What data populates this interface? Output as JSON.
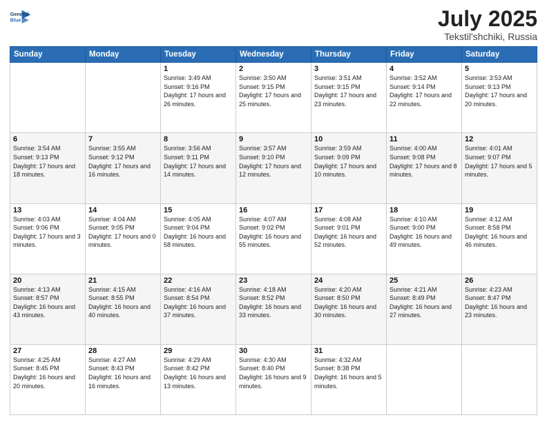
{
  "header": {
    "title": "July 2025",
    "subtitle": "Tekstil'shchiki, Russia"
  },
  "logo": {
    "line1": "General",
    "line2": "Blue"
  },
  "days_of_week": [
    "Sunday",
    "Monday",
    "Tuesday",
    "Wednesday",
    "Thursday",
    "Friday",
    "Saturday"
  ],
  "weeks": [
    [
      {
        "day": "",
        "info": ""
      },
      {
        "day": "",
        "info": ""
      },
      {
        "day": "1",
        "info": "Sunrise: 3:49 AM\nSunset: 9:16 PM\nDaylight: 17 hours and 26 minutes."
      },
      {
        "day": "2",
        "info": "Sunrise: 3:50 AM\nSunset: 9:15 PM\nDaylight: 17 hours and 25 minutes."
      },
      {
        "day": "3",
        "info": "Sunrise: 3:51 AM\nSunset: 9:15 PM\nDaylight: 17 hours and 23 minutes."
      },
      {
        "day": "4",
        "info": "Sunrise: 3:52 AM\nSunset: 9:14 PM\nDaylight: 17 hours and 22 minutes."
      },
      {
        "day": "5",
        "info": "Sunrise: 3:53 AM\nSunset: 9:13 PM\nDaylight: 17 hours and 20 minutes."
      }
    ],
    [
      {
        "day": "6",
        "info": "Sunrise: 3:54 AM\nSunset: 9:13 PM\nDaylight: 17 hours and 18 minutes."
      },
      {
        "day": "7",
        "info": "Sunrise: 3:55 AM\nSunset: 9:12 PM\nDaylight: 17 hours and 16 minutes."
      },
      {
        "day": "8",
        "info": "Sunrise: 3:56 AM\nSunset: 9:11 PM\nDaylight: 17 hours and 14 minutes."
      },
      {
        "day": "9",
        "info": "Sunrise: 3:57 AM\nSunset: 9:10 PM\nDaylight: 17 hours and 12 minutes."
      },
      {
        "day": "10",
        "info": "Sunrise: 3:59 AM\nSunset: 9:09 PM\nDaylight: 17 hours and 10 minutes."
      },
      {
        "day": "11",
        "info": "Sunrise: 4:00 AM\nSunset: 9:08 PM\nDaylight: 17 hours and 8 minutes."
      },
      {
        "day": "12",
        "info": "Sunrise: 4:01 AM\nSunset: 9:07 PM\nDaylight: 17 hours and 5 minutes."
      }
    ],
    [
      {
        "day": "13",
        "info": "Sunrise: 4:03 AM\nSunset: 9:06 PM\nDaylight: 17 hours and 3 minutes."
      },
      {
        "day": "14",
        "info": "Sunrise: 4:04 AM\nSunset: 9:05 PM\nDaylight: 17 hours and 0 minutes."
      },
      {
        "day": "15",
        "info": "Sunrise: 4:05 AM\nSunset: 9:04 PM\nDaylight: 16 hours and 58 minutes."
      },
      {
        "day": "16",
        "info": "Sunrise: 4:07 AM\nSunset: 9:02 PM\nDaylight: 16 hours and 55 minutes."
      },
      {
        "day": "17",
        "info": "Sunrise: 4:08 AM\nSunset: 9:01 PM\nDaylight: 16 hours and 52 minutes."
      },
      {
        "day": "18",
        "info": "Sunrise: 4:10 AM\nSunset: 9:00 PM\nDaylight: 16 hours and 49 minutes."
      },
      {
        "day": "19",
        "info": "Sunrise: 4:12 AM\nSunset: 8:58 PM\nDaylight: 16 hours and 46 minutes."
      }
    ],
    [
      {
        "day": "20",
        "info": "Sunrise: 4:13 AM\nSunset: 8:57 PM\nDaylight: 16 hours and 43 minutes."
      },
      {
        "day": "21",
        "info": "Sunrise: 4:15 AM\nSunset: 8:55 PM\nDaylight: 16 hours and 40 minutes."
      },
      {
        "day": "22",
        "info": "Sunrise: 4:16 AM\nSunset: 8:54 PM\nDaylight: 16 hours and 37 minutes."
      },
      {
        "day": "23",
        "info": "Sunrise: 4:18 AM\nSunset: 8:52 PM\nDaylight: 16 hours and 33 minutes."
      },
      {
        "day": "24",
        "info": "Sunrise: 4:20 AM\nSunset: 8:50 PM\nDaylight: 16 hours and 30 minutes."
      },
      {
        "day": "25",
        "info": "Sunrise: 4:21 AM\nSunset: 8:49 PM\nDaylight: 16 hours and 27 minutes."
      },
      {
        "day": "26",
        "info": "Sunrise: 4:23 AM\nSunset: 8:47 PM\nDaylight: 16 hours and 23 minutes."
      }
    ],
    [
      {
        "day": "27",
        "info": "Sunrise: 4:25 AM\nSunset: 8:45 PM\nDaylight: 16 hours and 20 minutes."
      },
      {
        "day": "28",
        "info": "Sunrise: 4:27 AM\nSunset: 8:43 PM\nDaylight: 16 hours and 16 minutes."
      },
      {
        "day": "29",
        "info": "Sunrise: 4:29 AM\nSunset: 8:42 PM\nDaylight: 16 hours and 13 minutes."
      },
      {
        "day": "30",
        "info": "Sunrise: 4:30 AM\nSunset: 8:40 PM\nDaylight: 16 hours and 9 minutes."
      },
      {
        "day": "31",
        "info": "Sunrise: 4:32 AM\nSunset: 8:38 PM\nDaylight: 16 hours and 5 minutes."
      },
      {
        "day": "",
        "info": ""
      },
      {
        "day": "",
        "info": ""
      }
    ]
  ]
}
